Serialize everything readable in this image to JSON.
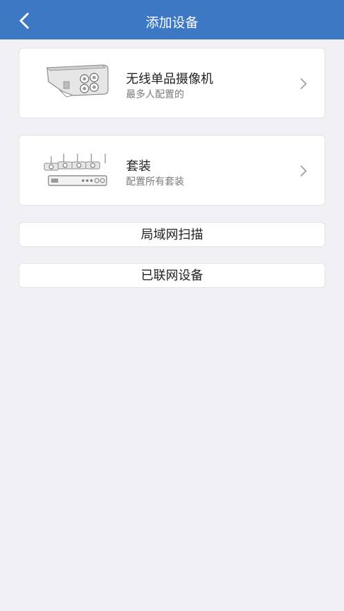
{
  "header": {
    "title": "添加设备",
    "back_icon": "chevron-left-icon"
  },
  "cards": [
    {
      "title": "无线单品摄像机",
      "subtitle": "最多人配置的",
      "image": "bullet-camera-image",
      "arrow_icon": "chevron-right-icon"
    },
    {
      "title": "套装",
      "subtitle": "配置所有套装",
      "image": "nvr-kit-image",
      "arrow_icon": "chevron-right-icon"
    }
  ],
  "buttons": {
    "lan_scan": "局域网扫描",
    "connected_devices": "已联网设备"
  },
  "colors": {
    "header_bg": "#3c78c4",
    "page_bg": "#f0f0f5",
    "card_bg": "#ffffff"
  }
}
